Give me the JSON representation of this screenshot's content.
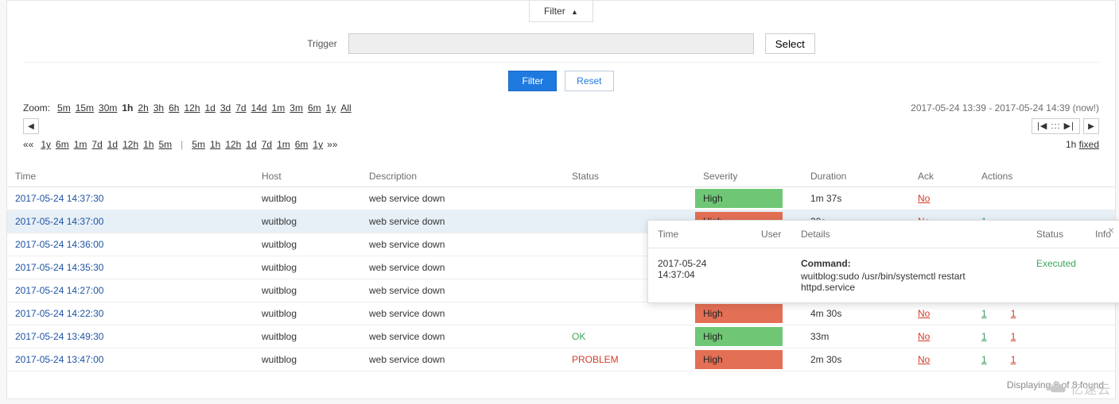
{
  "filter_tab": {
    "label": "Filter",
    "arrow": "▲"
  },
  "filter_form": {
    "trigger_label": "Trigger",
    "trigger_value": "",
    "select_label": "Select",
    "filter_btn": "Filter",
    "reset_btn": "Reset"
  },
  "zoom": {
    "label": "Zoom:",
    "options": [
      "5m",
      "15m",
      "30m",
      "1h",
      "2h",
      "3h",
      "6h",
      "12h",
      "1d",
      "3d",
      "7d",
      "14d",
      "1m",
      "3m",
      "6m",
      "1y",
      "All"
    ],
    "active": "1h"
  },
  "time_range": "2017-05-24 13:39 - 2017-05-24 14:39 (now!)",
  "nav": {
    "left": "◀",
    "right": "▶",
    "center": "|◀ ::: ▶|"
  },
  "zoom2": {
    "prefix": "««",
    "suffix": "»»",
    "left_set": [
      "1y",
      "6m",
      "1m",
      "7d",
      "1d",
      "12h",
      "1h",
      "5m"
    ],
    "right_set": [
      "5m",
      "1h",
      "12h",
      "1d",
      "7d",
      "1m",
      "6m",
      "1y"
    ],
    "right_label_1h": "1h",
    "right_label_fixed": "fixed"
  },
  "table": {
    "headers": {
      "time": "Time",
      "host": "Host",
      "description": "Description",
      "status": "Status",
      "severity": "Severity",
      "duration": "Duration",
      "ack": "Ack",
      "actions": "Actions"
    },
    "rows": [
      {
        "time": "2017-05-24 14:37:30",
        "host": "wuitblog",
        "description": "web service down",
        "status": "",
        "status_class": "",
        "severity": "High",
        "severity_class": "sev-green",
        "duration": "1m 37s",
        "ack": "No",
        "actions_green": "",
        "actions_red": "",
        "highlight": false
      },
      {
        "time": "2017-05-24 14:37:00",
        "host": "wuitblog",
        "description": "web service down",
        "status": "",
        "status_class": "",
        "severity": "High",
        "severity_class": "sev-red",
        "duration": "30s",
        "ack": "No",
        "actions_green": "1",
        "actions_red": "",
        "highlight": true
      },
      {
        "time": "2017-05-24 14:36:00",
        "host": "wuitblog",
        "description": "web service down",
        "status": "",
        "status_class": "",
        "severity": "",
        "severity_class": "",
        "duration": "",
        "ack": "",
        "actions_green": "",
        "actions_red": "",
        "highlight": false
      },
      {
        "time": "2017-05-24 14:35:30",
        "host": "wuitblog",
        "description": "web service down",
        "status": "",
        "status_class": "",
        "severity": "",
        "severity_class": "",
        "duration": "",
        "ack": "",
        "actions_green": "",
        "actions_red": "",
        "highlight": false
      },
      {
        "time": "2017-05-24 14:27:00",
        "host": "wuitblog",
        "description": "web service down",
        "status": "",
        "status_class": "",
        "severity": "",
        "severity_class": "",
        "duration": "",
        "ack": "",
        "actions_green": "",
        "actions_red": "",
        "highlight": false
      },
      {
        "time": "2017-05-24 14:22:30",
        "host": "wuitblog",
        "description": "web service down",
        "status": "",
        "status_class": "",
        "severity": "High",
        "severity_class": "sev-red",
        "duration": "4m 30s",
        "ack": "No",
        "actions_green": "1",
        "actions_red": "1",
        "highlight": false
      },
      {
        "time": "2017-05-24 13:49:30",
        "host": "wuitblog",
        "description": "web service down",
        "status": "OK",
        "status_class": "status-ok",
        "severity": "High",
        "severity_class": "sev-green",
        "duration": "33m",
        "ack": "No",
        "actions_green": "1",
        "actions_red": "1",
        "highlight": false
      },
      {
        "time": "2017-05-24 13:47:00",
        "host": "wuitblog",
        "description": "web service down",
        "status": "PROBLEM",
        "status_class": "status-problem",
        "severity": "High",
        "severity_class": "sev-red",
        "duration": "2m 30s",
        "ack": "No",
        "actions_green": "1",
        "actions_red": "1",
        "highlight": false
      }
    ]
  },
  "footer": "Displaying 8 of 8 found",
  "popup": {
    "headers": {
      "time": "Time",
      "user": "User",
      "details": "Details",
      "status": "Status",
      "info": "Info"
    },
    "close": "×",
    "row": {
      "time": "2017-05-24 14:37:04",
      "user": "",
      "command_label": "Command:",
      "command": "wuitblog:sudo /usr/bin/systemctl restart httpd.service",
      "status": "Executed",
      "info": ""
    }
  },
  "watermark": "亿速云"
}
